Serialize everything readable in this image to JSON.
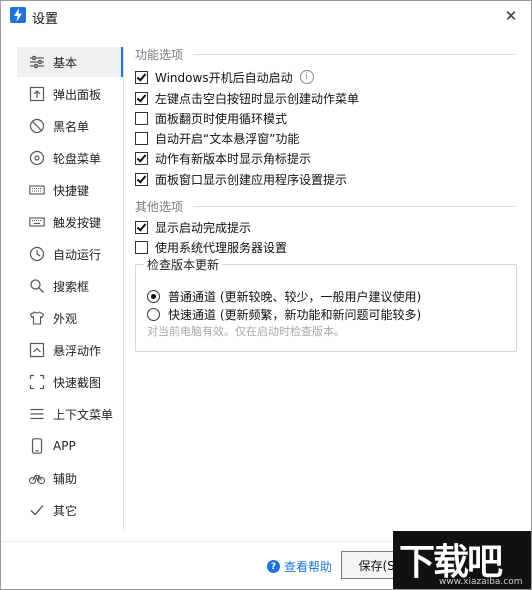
{
  "window": {
    "title": "设置",
    "close_glyph": "✕"
  },
  "sidebar": {
    "items": [
      {
        "label": "基本",
        "icon": "sliders-icon",
        "active": true
      },
      {
        "label": "弹出面板",
        "icon": "popup-panel-icon"
      },
      {
        "label": "黑名单",
        "icon": "block-icon"
      },
      {
        "label": "轮盘菜单",
        "icon": "wheel-menu-icon"
      },
      {
        "label": "快捷键",
        "icon": "keyboard-icon"
      },
      {
        "label": "触发按键",
        "icon": "trigger-key-icon"
      },
      {
        "label": "自动运行",
        "icon": "clock-icon"
      },
      {
        "label": "搜索框",
        "icon": "search-icon"
      },
      {
        "label": "外观",
        "icon": "shirt-icon"
      },
      {
        "label": "悬浮动作",
        "icon": "float-action-icon"
      },
      {
        "label": "快速截图",
        "icon": "screenshot-icon"
      },
      {
        "label": "上下文菜单",
        "icon": "context-menu-icon"
      },
      {
        "label": "APP",
        "icon": "phone-icon"
      },
      {
        "label": "辅助",
        "icon": "bicycle-icon"
      },
      {
        "label": "其它",
        "icon": "checkmark-icon"
      }
    ]
  },
  "function_options": {
    "title": "功能选项",
    "items": [
      {
        "label": "Windows开机后自动启动",
        "checked": true,
        "info": true
      },
      {
        "label": "左键点击空白按钮时显示创建动作菜单",
        "checked": true
      },
      {
        "label": "面板翻页时使用循环模式",
        "checked": false
      },
      {
        "label": "自动开启“文本悬浮窗”功能",
        "checked": false
      },
      {
        "label": "动作有新版本时显示角标提示",
        "checked": true
      },
      {
        "label": "面板窗口显示创建应用程序设置提示",
        "checked": true
      }
    ]
  },
  "other_options": {
    "title": "其他选项",
    "items": [
      {
        "label": "显示启动完成提示",
        "checked": true
      },
      {
        "label": "使用系统代理服务器设置",
        "checked": false
      }
    ]
  },
  "update_check": {
    "title": "检查版本更新",
    "options": [
      {
        "label": "普通通道 (更新较晚、较少，一般用户建议使用)",
        "selected": true
      },
      {
        "label": "快速通道 (更新频繁，新功能和新问题可能较多)",
        "selected": false
      }
    ],
    "hint": "对当前电脑有效。仅在启动时检查版本。"
  },
  "footer": {
    "help_label": "查看帮助",
    "save_label": "保存(S)"
  },
  "watermark": {
    "logo": "下载吧",
    "url": "www.xiazaiba.com"
  },
  "colors": {
    "accent": "#1e73d8",
    "section_title": "#7c7c7c",
    "hint": "#a8a8a8"
  }
}
